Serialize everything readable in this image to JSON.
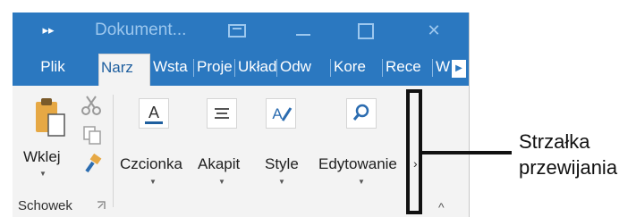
{
  "titlebar": {
    "qat_icon": "chevrons-right-icon",
    "document_title": "Dokument...",
    "controls": [
      "ribbon-display-icon",
      "minimize-icon",
      "maximize-icon",
      "close-icon"
    ]
  },
  "tabs": [
    "Plik",
    "Narz",
    "Wsta",
    "Proje",
    "Układ",
    "Odw",
    "Kore",
    "Rece",
    "W"
  ],
  "active_tab": "Narz",
  "ribbon": {
    "clipboard": {
      "paste_label": "Wklej",
      "group_label": "Schowek"
    },
    "font_label": "Czcionka",
    "paragraph_label": "Akapit",
    "styles_label": "Style",
    "editing_label": "Edytowanie",
    "scroll_glyph": "›",
    "collapse_glyph": "^"
  },
  "callout": {
    "line1": "Strzałka",
    "line2": "przewijania"
  },
  "colors": {
    "accent": "#2b78c0",
    "ribbon_bg": "#f3f3f3"
  }
}
